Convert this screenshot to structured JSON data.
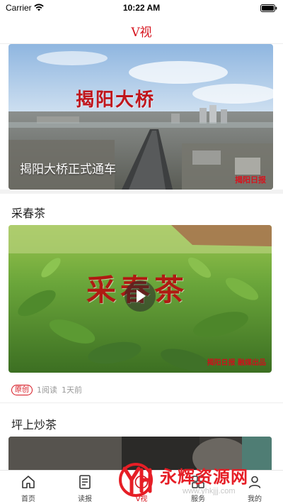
{
  "status_bar": {
    "carrier": "Carrier",
    "time": "10:22 AM"
  },
  "nav": {
    "title": "V视"
  },
  "feed": {
    "hero": {
      "title": "揭阳大桥正式通车",
      "image_text": "揭阳大桥",
      "watermark": "揭阳日报"
    },
    "posts": [
      {
        "title": "采春茶",
        "image_text": "采春茶",
        "watermark": "揭阳日报 融媒出品",
        "badge": "原创",
        "reads": "1阅读",
        "time_ago": "1天前"
      },
      {
        "title": "坪上炒茶"
      }
    ]
  },
  "tab_bar": {
    "items": [
      {
        "label": "首页",
        "icon": "home-icon"
      },
      {
        "label": "读报",
        "icon": "newspaper-icon"
      },
      {
        "label": "V视",
        "icon": "video-icon",
        "active": true
      },
      {
        "label": "服务",
        "icon": "service-icon"
      },
      {
        "label": "我的",
        "icon": "user-icon"
      }
    ]
  },
  "overlay_watermark": {
    "text": "永辉资源网",
    "url": "www.yhkjjj.com"
  },
  "colors": {
    "accent": "#d6141e",
    "divider": "#eeeeee"
  }
}
